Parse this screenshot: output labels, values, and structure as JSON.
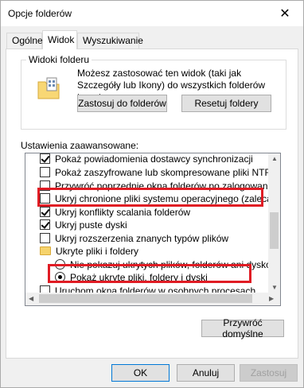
{
  "window": {
    "title": "Opcje folderów",
    "close_glyph": "✕"
  },
  "tabs": [
    {
      "label": "Ogólne"
    },
    {
      "label": "Widok"
    },
    {
      "label": "Wyszukiwanie"
    }
  ],
  "folder_views": {
    "title": "Widoki folderu",
    "description": "Możesz zastosować ten widok (taki jak Szczegóły lub Ikony) do wszystkich folderów tego typu.",
    "apply_label": "Zastosuj do folderów",
    "reset_label": "Resetuj foldery"
  },
  "advanced": {
    "label": "Ustawienia zaawansowane:",
    "items": [
      {
        "type": "checkbox",
        "checked": true,
        "label": "Pokaż powiadomienia dostawcy synchronizacji"
      },
      {
        "type": "checkbox",
        "checked": false,
        "label": "Pokaż zaszyfrowane lub skompresowane pliki NTFS w ko"
      },
      {
        "type": "checkbox",
        "checked": false,
        "label": "Przywróć poprzednie okna folderów po zalogowaniu"
      },
      {
        "type": "checkbox",
        "checked": false,
        "label": "Ukryj chronione pliki systemu operacyjnego (zalecane)"
      },
      {
        "type": "checkbox",
        "checked": true,
        "label": "Ukryj konflikty scalania folderów"
      },
      {
        "type": "checkbox",
        "checked": true,
        "label": "Ukryj puste dyski"
      },
      {
        "type": "checkbox",
        "checked": false,
        "label": "Ukryj rozszerzenia znanych typów plików"
      },
      {
        "type": "folder",
        "label": "Ukryte pliki i foldery"
      },
      {
        "type": "radio",
        "checked": false,
        "label": "Nie pokazuj ukrytych plików, folderów ani dysków"
      },
      {
        "type": "radio",
        "checked": true,
        "label": "Pokaż ukryte pliki, foldery i dyski"
      },
      {
        "type": "checkbox",
        "checked": false,
        "label": "Uruchom okna folderów w osobnych procesach"
      }
    ]
  },
  "restore_defaults_label": "Przywróć domyślne",
  "footer": {
    "ok_label": "OK",
    "cancel_label": "Anuluj",
    "apply_label": "Zastosuj"
  },
  "colors": {
    "highlight": "#e01c24",
    "folder": "#f6d36c"
  }
}
